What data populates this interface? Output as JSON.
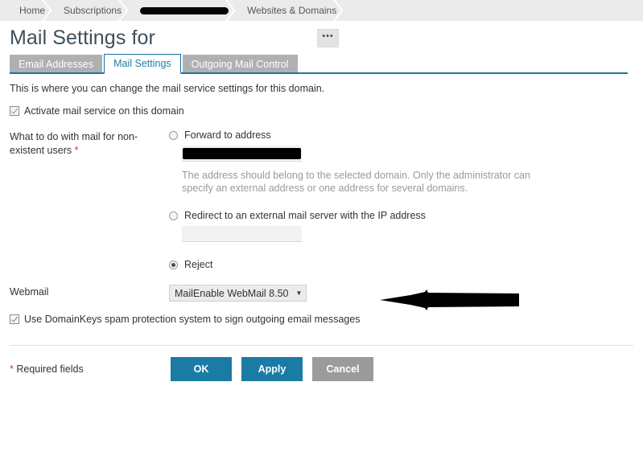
{
  "breadcrumb": {
    "items": [
      {
        "label": "Home",
        "redacted": false
      },
      {
        "label": "Subscriptions",
        "redacted": false
      },
      {
        "label": "",
        "redacted": true
      },
      {
        "label": "Websites & Domains",
        "redacted": false
      }
    ]
  },
  "header": {
    "title": "Mail Settings for ",
    "more_button_label": "•••"
  },
  "tabs": [
    {
      "label": "Email Addresses",
      "active": false
    },
    {
      "label": "Mail Settings",
      "active": true
    },
    {
      "label": "Outgoing Mail Control",
      "active": false
    }
  ],
  "main": {
    "intro": "This is where you can change the mail service settings for this domain.",
    "activate_checkbox": {
      "label": "Activate mail service on this domain",
      "checked": true
    },
    "nonexistent_users": {
      "label": "What to do with mail for non-existent users",
      "required_marker": "*",
      "options": [
        {
          "label": "Forward to address",
          "selected": false,
          "input_value": "",
          "input_redacted": true,
          "hint": "The address should belong to the selected domain. Only the administrator can specify an external address or one address for several domains."
        },
        {
          "label": "Redirect to an external mail server with the IP address",
          "selected": false,
          "input_value": "",
          "input_redacted": false,
          "hint": ""
        },
        {
          "label": "Reject",
          "selected": true,
          "input_value": "",
          "input_redacted": false,
          "hint": ""
        }
      ]
    },
    "webmail": {
      "label": "Webmail",
      "selected_value": "MailEnable WebMail 8.50",
      "caret": "▼"
    },
    "domainkeys_checkbox": {
      "label": "Use DomainKeys spam protection system to sign outgoing email messages",
      "checked": true
    }
  },
  "footer": {
    "required_marker": "*",
    "required_text": " Required fields",
    "ok_label": "OK",
    "apply_label": "Apply",
    "cancel_label": "Cancel"
  },
  "colors": {
    "accent_blue": "#1a7ba5",
    "tab_inactive": "#b0b0b0",
    "cancel_gray": "#9b9b9b",
    "breadcrumb_bg": "#ebebeb",
    "title_text": "#3d4f5d",
    "required_red": "#c0392b",
    "annotation": "#000000"
  },
  "annotations": {
    "arrow": {
      "name": "left-pointing-arrow",
      "points_to": "domainkeys-checkbox-row",
      "direction": "left"
    }
  }
}
